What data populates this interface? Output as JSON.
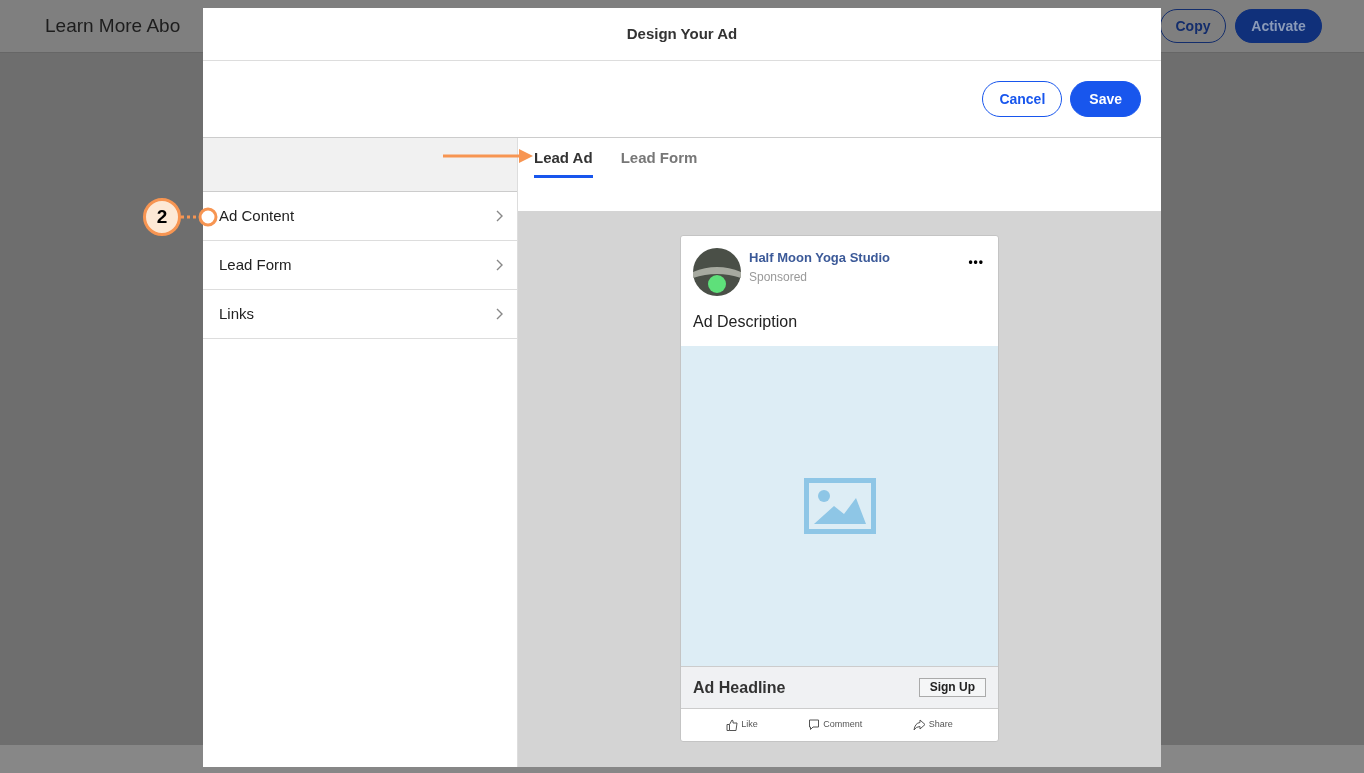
{
  "background_page": {
    "title": "Learn More Abo",
    "buttons": [
      {
        "label": "Copy",
        "kind": "outline"
      },
      {
        "label": "Activate",
        "kind": "filled"
      }
    ]
  },
  "dialog": {
    "title": "Design Your Ad",
    "buttons": [
      {
        "label": "Cancel",
        "kind": "outline"
      },
      {
        "label": "Save",
        "kind": "filled"
      }
    ],
    "sidebar": {
      "items": [
        {
          "label": "Ad Content"
        },
        {
          "label": "Lead Form"
        },
        {
          "label": "Links"
        }
      ]
    },
    "tabs": [
      {
        "label": "Lead Ad",
        "selected": true
      },
      {
        "label": "Lead Form",
        "selected": false
      }
    ],
    "ad_preview": {
      "page_name": "Half Moon Yoga Studio",
      "subtitle": "Sponsored",
      "menu": "•••",
      "description": "Ad Description",
      "headline": "Ad Headline",
      "cta": "Sign Up",
      "actions": [
        {
          "label": "Like",
          "kind": "like"
        },
        {
          "label": "Comment",
          "kind": "comment"
        },
        {
          "label": "Share",
          "kind": "share"
        }
      ]
    }
  },
  "annotations": {
    "callout": "2"
  }
}
